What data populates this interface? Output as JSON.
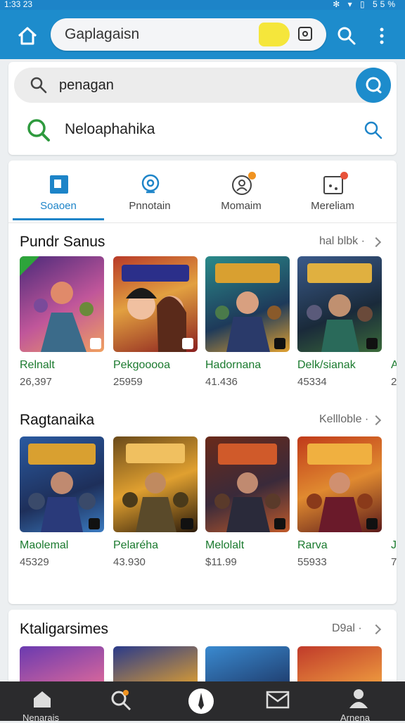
{
  "status": {
    "time": "1:33 23",
    "icons": "✻ ▾ ▯ 55%",
    "battery": "55%"
  },
  "browser": {
    "url_text": "Gaplagaisn",
    "home_icon": "home-icon",
    "search_icon": "search-icon",
    "more_icon": "more-vertical-icon"
  },
  "search": {
    "query": "penagan",
    "suggestion": "Nelоaphahika"
  },
  "tabs": [
    {
      "label": "Soaoen",
      "icon": "store-icon",
      "active": true
    },
    {
      "label": "Pnnotain",
      "icon": "compass-icon",
      "active": false
    },
    {
      "label": "Momaim",
      "icon": "user-icon",
      "active": false
    },
    {
      "label": "Mereliam",
      "icon": "grid-icon",
      "active": false
    }
  ],
  "sections": [
    {
      "title": "Pundr Sanus",
      "more": "hal blbk ·",
      "games": [
        {
          "name": "Relnalt",
          "count": "26,397"
        },
        {
          "name": "Pekgooooa",
          "count": "25959"
        },
        {
          "name": "Hadornana",
          "count": "41.436"
        },
        {
          "name": "Delk/sianak",
          "count": "45334"
        },
        {
          "name": "A",
          "count": "2"
        }
      ]
    },
    {
      "title": "Ragtanaika",
      "more": "Kellloble ·",
      "games": [
        {
          "name": "Maolemal",
          "count": "45329"
        },
        {
          "name": "Pelaréha",
          "count": "43.930"
        },
        {
          "name": "Melolalt",
          "count": "$11.99"
        },
        {
          "name": "Rarva",
          "count": "55933"
        },
        {
          "name": "Jl",
          "count": "7"
        }
      ]
    },
    {
      "title": "Ktaligarsimes",
      "more": "D9al ·",
      "games": []
    }
  ],
  "bottom_nav": [
    {
      "label": "Nenarais",
      "icon": "home-icon"
    },
    {
      "label": "",
      "icon": "search-icon"
    },
    {
      "label": "",
      "icon": "compass-icon"
    },
    {
      "label": "",
      "icon": "mail-icon"
    },
    {
      "label": "Arnena",
      "icon": "account-icon"
    }
  ],
  "colors": {
    "accent": "#1d8ccc",
    "game_name": "#1a7a2e",
    "bottom_bar": "#2b2b2d"
  }
}
